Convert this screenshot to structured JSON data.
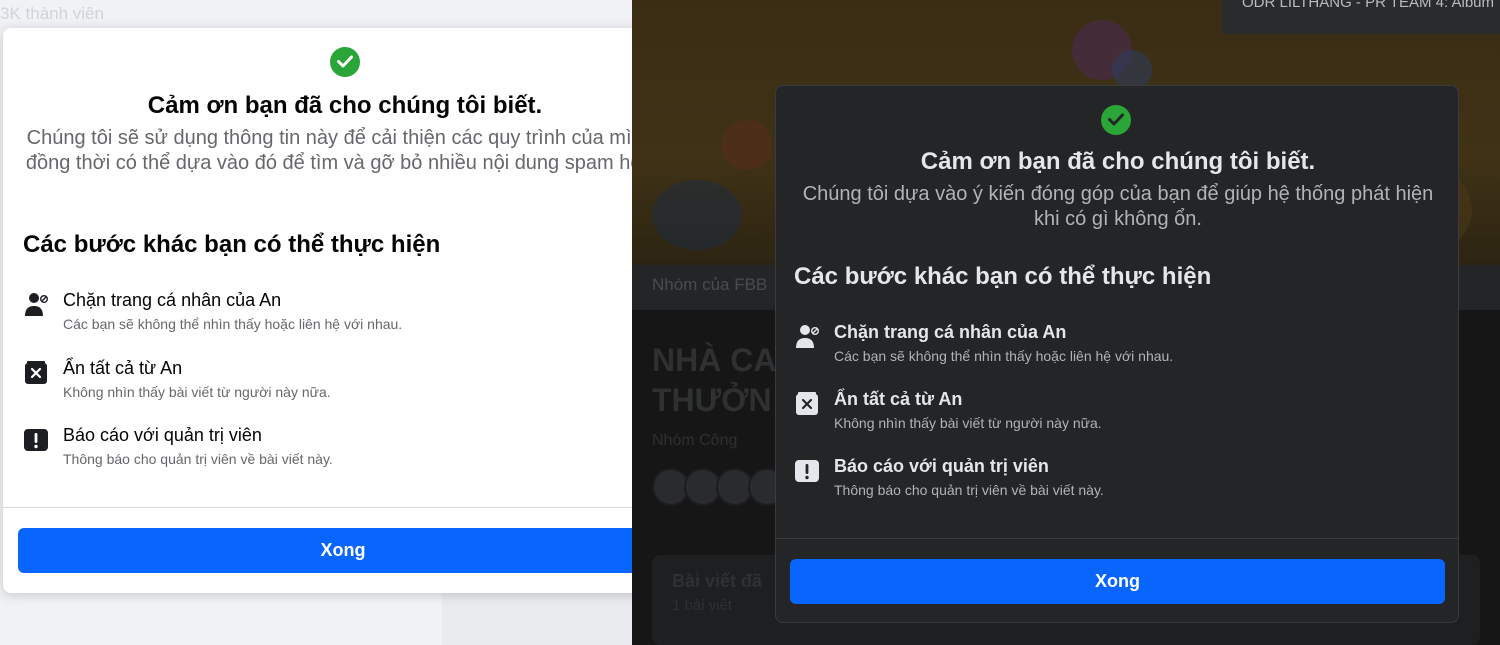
{
  "left_background": {
    "members_text": "3K thành viên"
  },
  "light_dialog": {
    "title": "Cảm ơn bạn đã cho chúng tôi biết.",
    "description": "Chúng tôi sẽ sử dụng thông tin này để cải thiện các quy trình của mình, đồng thời có thể dựa vào đó để tìm và gỡ bỏ nhiều nội dung spam hơn.",
    "section_title": "Các bước khác bạn có thể thực hiện",
    "actions": [
      {
        "title": "Chặn trang cá nhân của An",
        "subtitle": "Các bạn sẽ không thể nhìn thấy hoặc liên hệ với nhau.",
        "icon": "block-user-icon"
      },
      {
        "title": "Ẩn tất cả từ An",
        "subtitle": "Không nhìn thấy bài viết từ người này nữa.",
        "icon": "hide-box-icon"
      },
      {
        "title": "Báo cáo với quản trị viên",
        "subtitle": "Thông báo cho quản trị viên về bài viết này.",
        "icon": "report-exclamation-icon"
      }
    ],
    "done_button": "Xong"
  },
  "right_background": {
    "notification_text": "ODR LILTHANG - PR TEAM 4: Album",
    "group_bar_text": "Nhóm của FBB",
    "group_name": "NHÀ CA\nTHƯỞN",
    "group_privacy": "Nhóm Công",
    "posts_title": "Bài viết đã",
    "posts_sub": "1 bài viết"
  },
  "dark_dialog": {
    "title": "Cảm ơn bạn đã cho chúng tôi biết.",
    "description": "Chúng tôi dựa vào ý kiến đóng góp của bạn để giúp hệ thống phát hiện khi có gì không ổn.",
    "section_title": "Các bước khác bạn có thể thực hiện",
    "actions": [
      {
        "title": "Chặn trang cá nhân của An",
        "subtitle": "Các bạn sẽ không thể nhìn thấy hoặc liên hệ với nhau.",
        "icon": "block-user-icon"
      },
      {
        "title": "Ẩn tất cả từ An",
        "subtitle": "Không nhìn thấy bài viết từ người này nữa.",
        "icon": "hide-box-icon"
      },
      {
        "title": "Báo cáo với quản trị viên",
        "subtitle": "Thông báo cho quản trị viên về bài viết này.",
        "icon": "report-exclamation-icon"
      }
    ],
    "done_button": "Xong"
  },
  "colors": {
    "accent_blue": "#0866ff",
    "success_green": "#2aa538",
    "dark_surface": "#242526",
    "light_surface": "#ffffff"
  }
}
